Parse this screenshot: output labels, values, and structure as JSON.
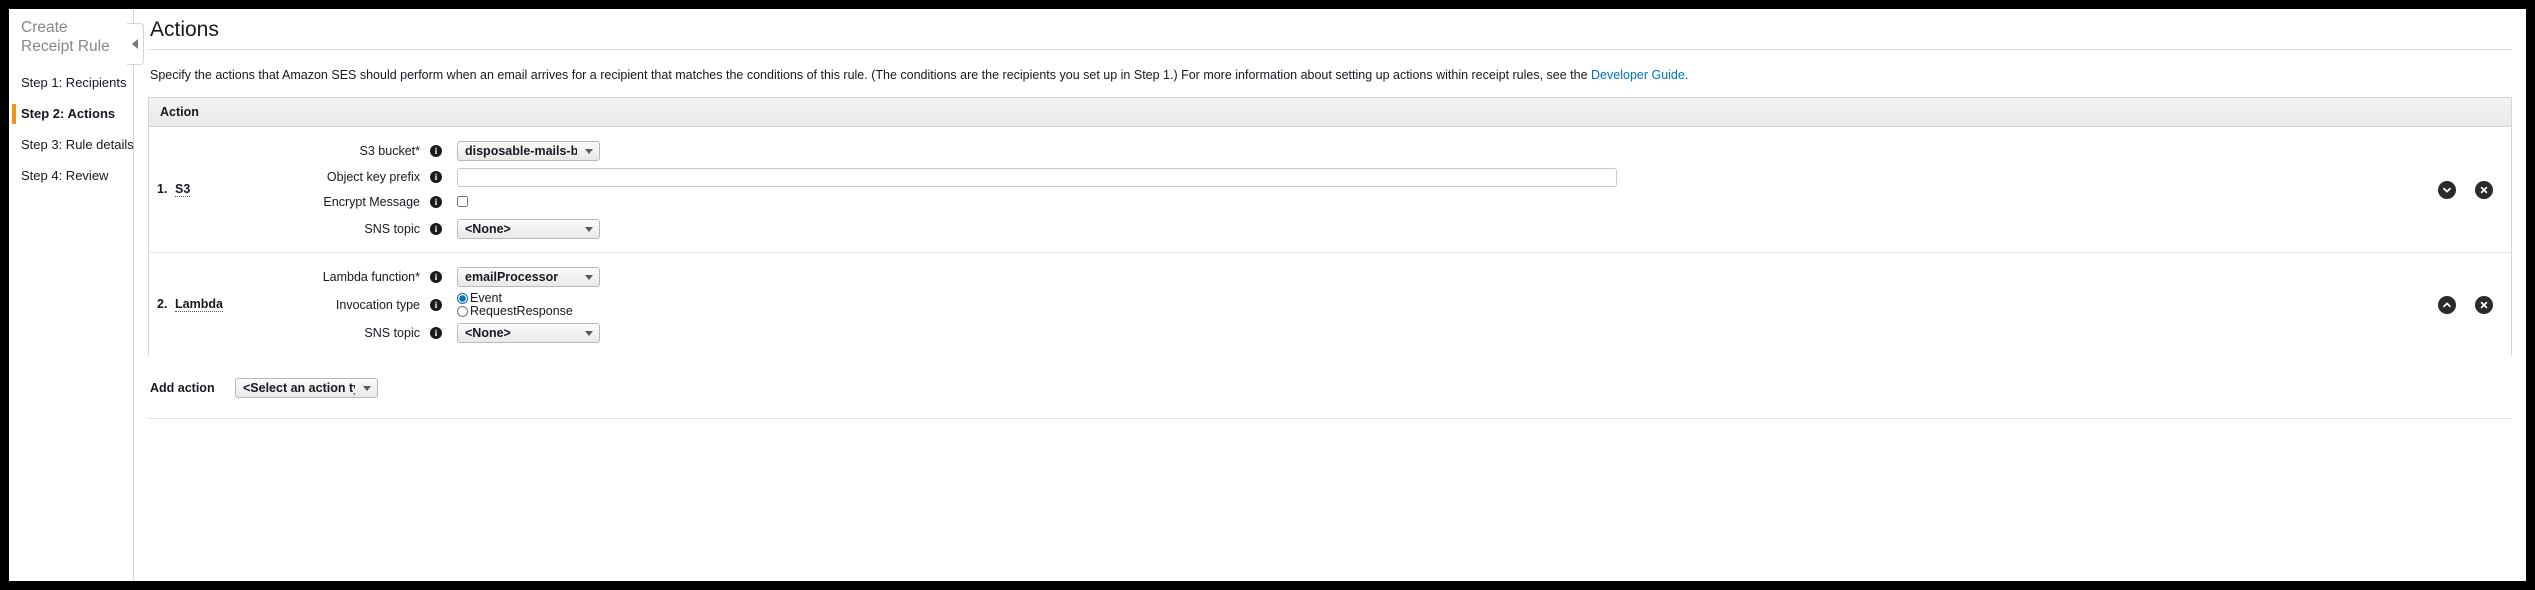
{
  "sidebar": {
    "title": "Create Receipt Rule",
    "steps": [
      {
        "label": "Step 1: Recipients",
        "active": false
      },
      {
        "label": "Step 2: Actions",
        "active": true
      },
      {
        "label": "Step 3: Rule details",
        "active": false
      },
      {
        "label": "Step 4: Review",
        "active": false
      }
    ],
    "collapse_icon": "chevron-left-icon"
  },
  "page": {
    "title": "Actions",
    "description_before_link": "Specify the actions that Amazon SES should perform when an email arrives for a recipient that matches the conditions of this rule. (The conditions are the recipients you set up in Step 1.) For more information about setting up actions within receipt rules, see the ",
    "description_link": "Developer Guide",
    "description_after_link": "."
  },
  "table": {
    "header": "Action",
    "info_glyph": "i"
  },
  "actions": [
    {
      "index": "1.",
      "name": "S3",
      "fields": {
        "bucket_label": "S3 bucket*",
        "bucket_value": "disposable-mails-bucket",
        "prefix_label": "Object key prefix",
        "prefix_value": "",
        "prefix_placeholder": "",
        "encrypt_label": "Encrypt Message",
        "encrypt_checked": false,
        "sns_label": "SNS topic",
        "sns_value": "<None>"
      },
      "controls": {
        "move_icon": "chevron-down-circle-icon",
        "remove_icon": "close-circle-icon"
      }
    },
    {
      "index": "2.",
      "name": "Lambda",
      "fields": {
        "function_label": "Lambda function*",
        "function_value": "emailProcessor",
        "invocation_label": "Invocation type",
        "invocation_options": [
          "Event",
          "RequestResponse"
        ],
        "invocation_selected": "Event",
        "sns_label": "SNS topic",
        "sns_value": "<None>"
      },
      "controls": {
        "move_icon": "chevron-up-circle-icon",
        "remove_icon": "close-circle-icon"
      }
    }
  ],
  "add_action": {
    "label": "Add action",
    "select_value": "<Select an action type>"
  },
  "colors": {
    "accent": "#f09316",
    "link": "#0073bb",
    "text": "#16191f",
    "border": "#d5d5d5"
  }
}
